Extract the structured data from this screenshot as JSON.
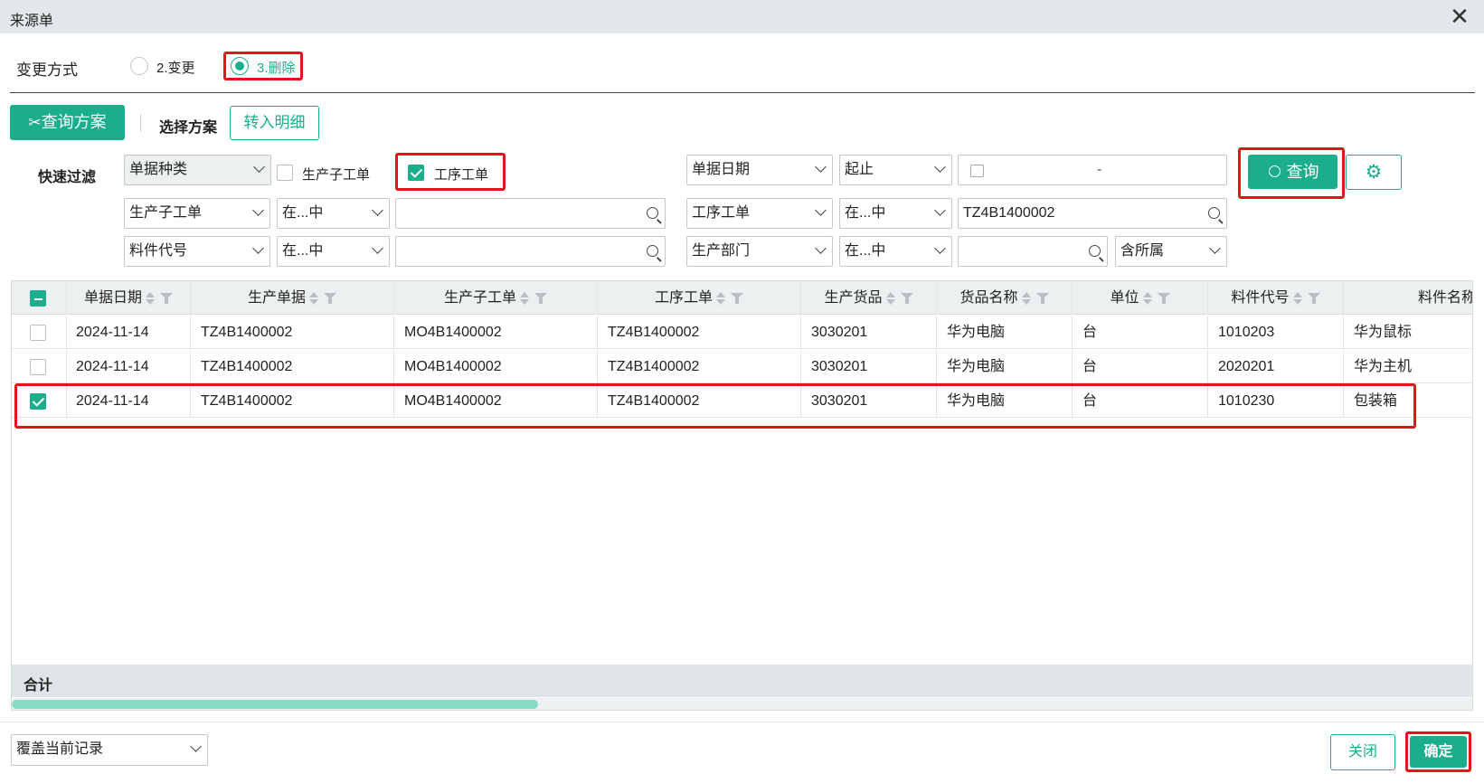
{
  "window": {
    "title": "来源单",
    "close_glyph": "✕"
  },
  "change_mode": {
    "label": "变更方式",
    "options": [
      {
        "label": "2.变更",
        "selected": false
      },
      {
        "label": "3.删除",
        "selected": true
      }
    ]
  },
  "toolbar": {
    "query_scheme": "查询方案",
    "select_scheme": "选择方案",
    "import_detail": "转入明细"
  },
  "filter": {
    "label": "快速过滤",
    "doc_type_select": "单据种类",
    "chk_sub_order": {
      "label": "生产子工单",
      "checked": false
    },
    "chk_process_order": {
      "label": "工序工单",
      "checked": true
    },
    "date_field": "单据日期",
    "date_range_mode": "起止",
    "date_range_sep": "-",
    "row2": {
      "field_a": "生产子工单",
      "op_a": "在...中",
      "value_a": "",
      "field_b": "工序工单",
      "op_b": "在...中",
      "value_b": "TZ4B1400002"
    },
    "row3": {
      "field_a": "料件代号",
      "op_a": "在...中",
      "value_a": "",
      "field_b": "生产部门",
      "op_b": "在...中",
      "value_b": "",
      "scope": "含所属"
    },
    "query_button": "查询"
  },
  "table": {
    "columns": [
      "单据日期",
      "生产单据",
      "生产子工单",
      "工序工单",
      "生产货品",
      "货品名称",
      "单位",
      "料件代号",
      "料件名称"
    ],
    "rows": [
      {
        "checked": false,
        "cells": [
          "2024-11-14",
          "TZ4B1400002",
          "MO4B1400002",
          "TZ4B1400002",
          "3030201",
          "华为电脑",
          "台",
          "1010203",
          "华为鼠标"
        ]
      },
      {
        "checked": false,
        "cells": [
          "2024-11-14",
          "TZ4B1400002",
          "MO4B1400002",
          "TZ4B1400002",
          "3030201",
          "华为电脑",
          "台",
          "2020201",
          "华为主机"
        ]
      },
      {
        "checked": true,
        "cells": [
          "2024-11-14",
          "TZ4B1400002",
          "MO4B1400002",
          "TZ4B1400002",
          "3030201",
          "华为电脑",
          "台",
          "1010230",
          "包装箱"
        ]
      }
    ],
    "sum_label": "合计",
    "scroll_fraction": 0.36
  },
  "footer": {
    "mode_select": "覆盖当前记录",
    "close_button": "关闭",
    "confirm_button": "确定"
  },
  "colors": {
    "accent": "#1aae8c",
    "highlight": "#e3141b",
    "header_bg": "#edf0f1"
  }
}
